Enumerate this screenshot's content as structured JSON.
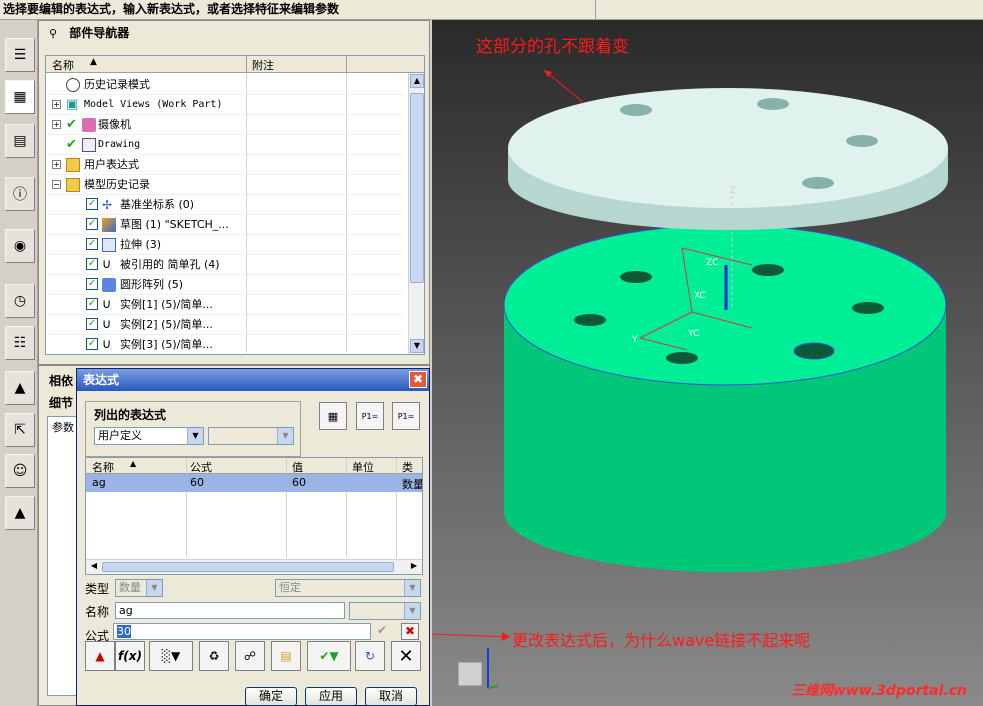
{
  "statusbar": {
    "message": "选择要编辑的表达式，输入新表达式，或者选择特征来编辑参数"
  },
  "navigator": {
    "title": "部件导航器",
    "columns": {
      "name": "名称",
      "attachment": "附注"
    },
    "rows": [
      {
        "label": "历史记录模式"
      },
      {
        "label": "Model Views (Work Part)"
      },
      {
        "label": "摄像机"
      },
      {
        "label": "Drawing"
      },
      {
        "label": "用户表达式"
      },
      {
        "label": "模型历史记录"
      },
      {
        "label": "基准坐标系 (0)"
      },
      {
        "label": "草图 (1) \"SKETCH_..."
      },
      {
        "label": "拉伸 (3)"
      },
      {
        "label": "被引用的 简单孔 (4)"
      },
      {
        "label": "圆形阵列 (5)"
      },
      {
        "label": "实例[1] (5)/简单..."
      },
      {
        "label": "实例[2] (5)/简单..."
      },
      {
        "label": "实例[3] (5)/简单..."
      }
    ]
  },
  "lower_panel": {
    "tab1": "相依",
    "tab2": "细节",
    "col": "参数"
  },
  "dialog": {
    "title": "表达式",
    "group_title": "列出的表达式",
    "list_filter": "用户定义",
    "table": {
      "headers": {
        "name": "名称",
        "formula": "公式",
        "value": "值",
        "unit": "单位",
        "type": "类型"
      },
      "rows": [
        {
          "name": "ag",
          "formula": "60",
          "value": "60",
          "type": "数量"
        }
      ]
    },
    "type_label": "类型",
    "type_value": "数量",
    "type_dim": "恒定",
    "name_label": "名称",
    "name_value": "ag",
    "formula_label": "公式",
    "formula_value": "30",
    "ok": "确定",
    "apply": "应用",
    "cancel": "取消"
  },
  "annotations": {
    "top": "这部分的孔不跟着变",
    "bottom": "更改表达式后，为什么wave链接不起来呢"
  },
  "watermark": "三维网www.3dportal.cn",
  "colors": {
    "top_disc": "#dff2ee",
    "bottom_cyl": "#00e38a",
    "annotation": "#ff1a1a"
  }
}
